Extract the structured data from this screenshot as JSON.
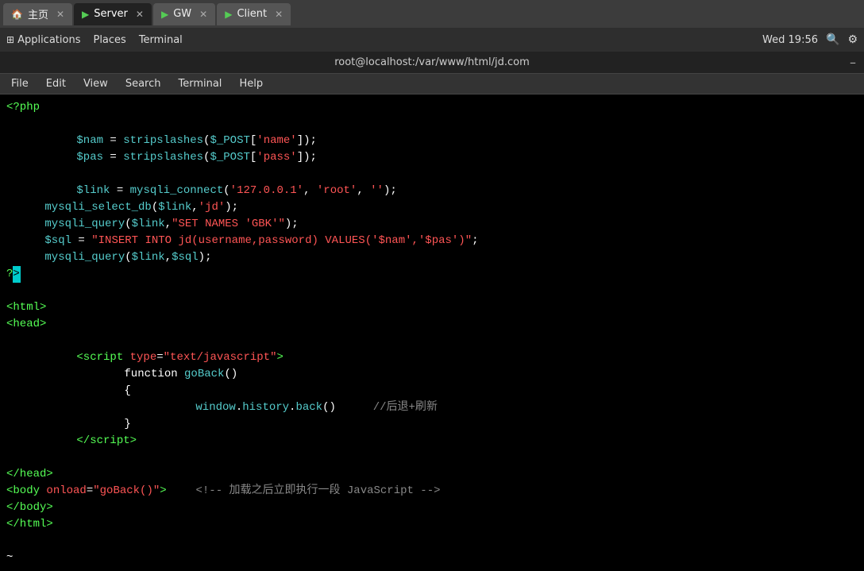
{
  "topbar": {
    "tabs": [
      {
        "id": "home",
        "label": "主页",
        "icon": "home-icon",
        "active": false,
        "closable": true
      },
      {
        "id": "server",
        "label": "Server",
        "icon": "terminal-icon",
        "active": true,
        "closable": true
      },
      {
        "id": "gw",
        "label": "GW",
        "icon": "terminal-icon",
        "active": false,
        "closable": true
      },
      {
        "id": "client",
        "label": "Client",
        "icon": "terminal-icon",
        "active": false,
        "closable": true
      }
    ]
  },
  "systembar": {
    "applications": "Applications",
    "places": "Places",
    "terminal": "Terminal",
    "time": "Wed 19:56"
  },
  "titlebar": {
    "title": "root@localhost:/var/www/html/jd.com"
  },
  "menubar": {
    "items": [
      "File",
      "Edit",
      "View",
      "Search",
      "Terminal",
      "Help"
    ]
  },
  "terminal": {
    "lines": []
  }
}
